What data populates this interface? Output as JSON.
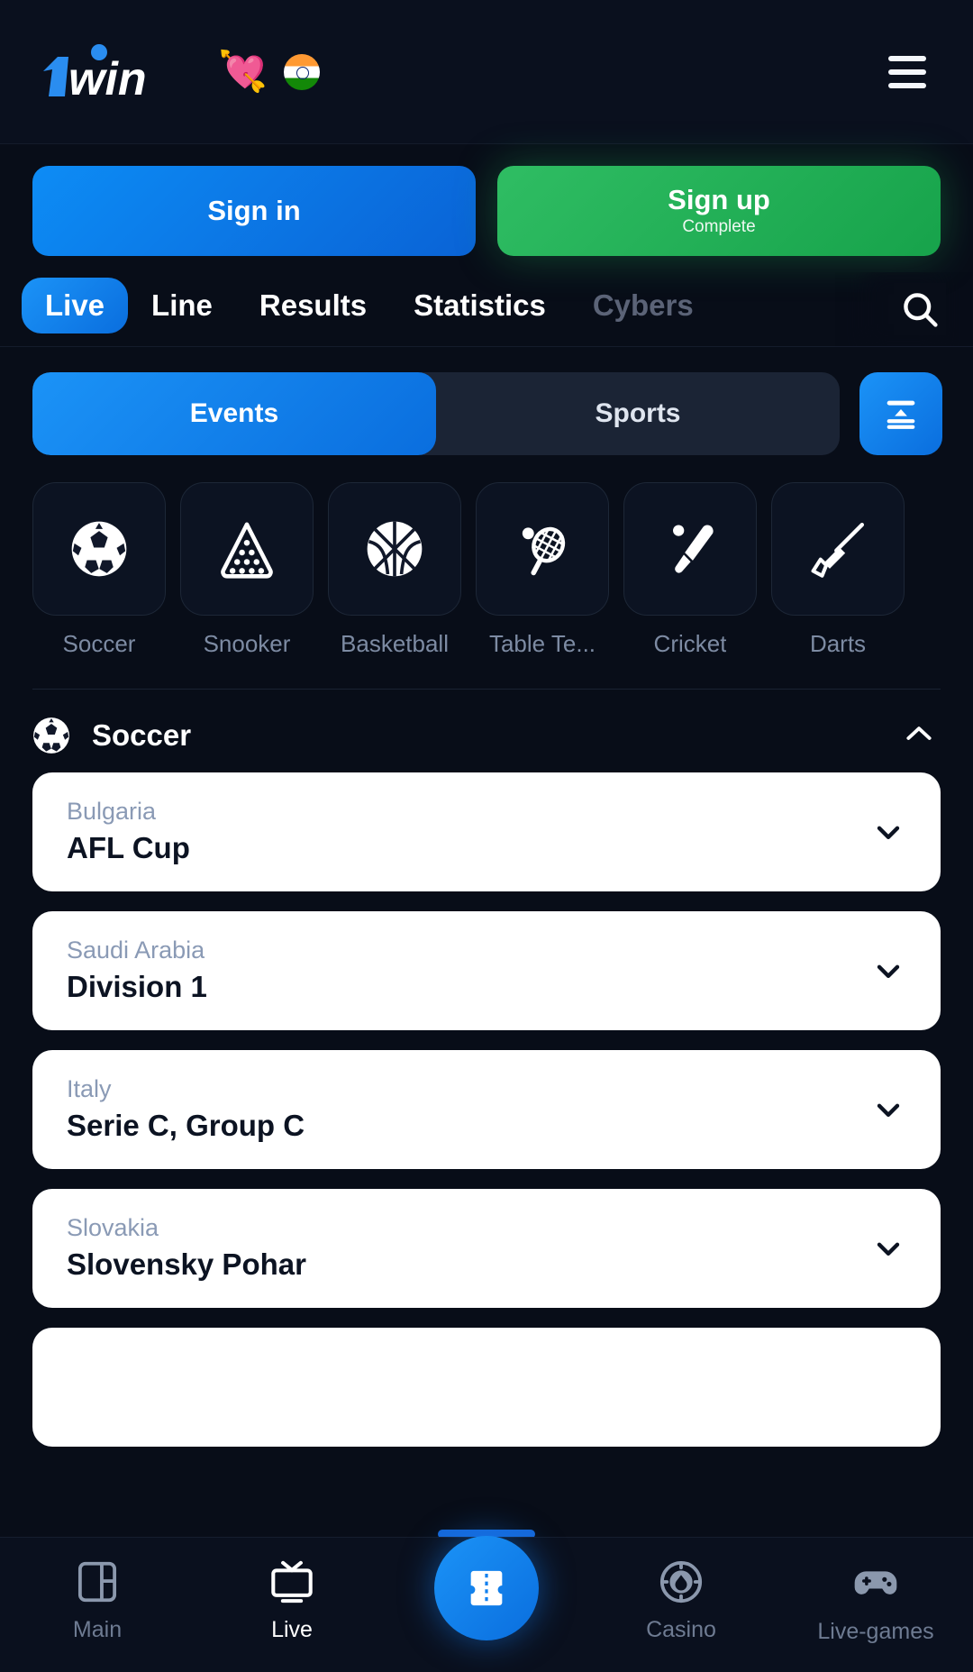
{
  "header": {
    "logo_text": "1win",
    "heart_icon": "heart-icon",
    "flag_icon": "india-flag-icon",
    "menu_icon": "hamburger-menu-icon"
  },
  "auth": {
    "sign_in_label": "Sign in",
    "sign_up_label": "Sign up",
    "sign_up_sub_label": "Complete",
    "sign_in_color": "#0d8cf5",
    "sign_up_color": "#2fbd63"
  },
  "top_tabs": {
    "items": [
      {
        "label": "Live",
        "active": true
      },
      {
        "label": "Line",
        "active": false
      },
      {
        "label": "Results",
        "active": false
      },
      {
        "label": "Statistics",
        "active": false
      },
      {
        "label": "Cybers",
        "active": false,
        "muted": true
      }
    ],
    "search_icon": "search-icon"
  },
  "segmented": {
    "events_label": "Events",
    "sports_label": "Sports",
    "active": "Events",
    "filter_icon": "sort-filter-icon"
  },
  "sports": [
    {
      "label": "Soccer",
      "icon": "soccer-ball-icon"
    },
    {
      "label": "Snooker",
      "icon": "snooker-rack-icon"
    },
    {
      "label": "Basketball",
      "icon": "basketball-icon"
    },
    {
      "label": "Table Te...",
      "icon": "table-tennis-icon"
    },
    {
      "label": "Cricket",
      "icon": "cricket-bat-icon"
    },
    {
      "label": "Darts",
      "icon": "dart-icon"
    }
  ],
  "section": {
    "title": "Soccer",
    "icon": "soccer-ball-icon",
    "collapse_icon": "chevron-up-icon",
    "expanded": true
  },
  "leagues": [
    {
      "country": "Bulgaria",
      "name": "AFL Cup"
    },
    {
      "country": "Saudi Arabia",
      "name": "Division 1"
    },
    {
      "country": "Italy",
      "name": "Serie C, Group C"
    },
    {
      "country": "Slovakia",
      "name": "Slovensky Pohar"
    }
  ],
  "bottom_nav": {
    "items": [
      {
        "label": "Main",
        "icon": "window-icon",
        "active": false
      },
      {
        "label": "Live",
        "icon": "tv-icon",
        "active": true
      },
      {
        "label": "",
        "icon": "betslip-icon",
        "active": false,
        "center": true
      },
      {
        "label": "Casino",
        "icon": "casino-chip-icon",
        "active": false
      },
      {
        "label": "Live-games",
        "icon": "gamepad-icon",
        "active": false
      }
    ]
  }
}
